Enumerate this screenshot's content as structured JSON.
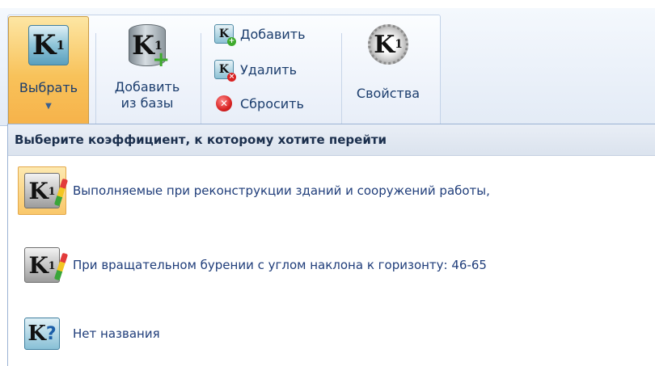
{
  "ribbon": {
    "select_button": {
      "label": "Выбрать",
      "icon": "k1-coefficient-icon"
    },
    "add_from_db_button": {
      "label_line1": "Добавить",
      "label_line2": "из базы",
      "icon": "k1-database-add-icon"
    },
    "small_buttons": [
      {
        "label": "Добавить",
        "icon": "k-add-icon"
      },
      {
        "label": "Удалить",
        "icon": "k-delete-icon"
      },
      {
        "label": "Сбросить",
        "icon": "reset-icon"
      }
    ],
    "properties_button": {
      "label": "Свойства",
      "icon": "k1-gear-icon"
    }
  },
  "menu": {
    "header": "Выберите коэффициент, к которому хотите перейти",
    "items": [
      {
        "label": "Выполняемые при реконструкции зданий и сооружений работы,",
        "icon": "k1-edit-icon",
        "selected": true
      },
      {
        "label": "При вращательном бурении с углом наклона к горизонту: 46-65",
        "icon": "k1-edit-icon",
        "selected": false
      },
      {
        "label": "Нет названия",
        "icon": "k-unknown-icon",
        "selected": false
      }
    ]
  },
  "colors": {
    "pressed_button": "#f8c25a",
    "menu_text": "#1f3d7a",
    "header_bg": "#dfe6f0"
  }
}
